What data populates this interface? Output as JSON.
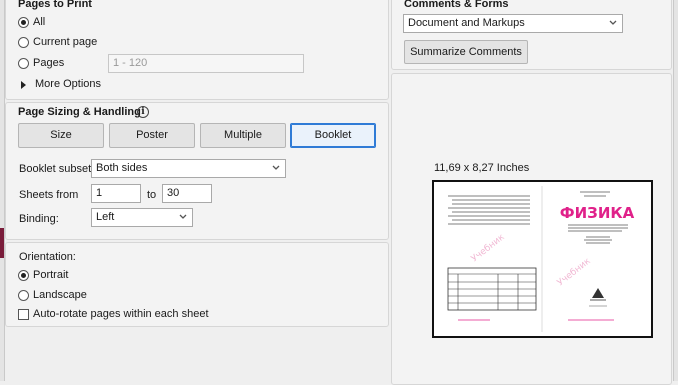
{
  "pages_to_print": {
    "title": "Pages to Print",
    "all_label": "All",
    "current_label": "Current page",
    "pages_label": "Pages",
    "pages_placeholder": "1 - 120",
    "more_options_label": "More Options"
  },
  "page_sizing": {
    "title": "Page Sizing & Handling",
    "info_glyph": "i",
    "buttons": [
      "Size",
      "Poster",
      "Multiple",
      "Booklet"
    ],
    "selected_button": "Booklet",
    "booklet_subset_label": "Booklet subset:",
    "booklet_subset_value": "Both sides",
    "sheets_from_label": "Sheets from",
    "sheets_from_value": "1",
    "sheets_to_label": "to",
    "sheets_to_value": "30",
    "binding_label": "Binding:",
    "binding_value": "Left"
  },
  "orientation": {
    "title": "Orientation:",
    "portrait_label": "Portrait",
    "landscape_label": "Landscape",
    "autorotate_label": "Auto-rotate pages within each sheet",
    "selected": "Portrait",
    "autorotate_checked": false
  },
  "comments_forms": {
    "title": "Comments & Forms",
    "select_value": "Document and Markups",
    "summarize_label": "Summarize Comments"
  },
  "preview": {
    "size_label": "11,69 x 8,27 Inches",
    "book_title": "ФИЗИКА",
    "book_title_color": "#e0218a",
    "watermark_color": "#f1b9d4"
  },
  "colors": {
    "accent": "#2f7bd6",
    "panel_bg": "#efefef"
  }
}
